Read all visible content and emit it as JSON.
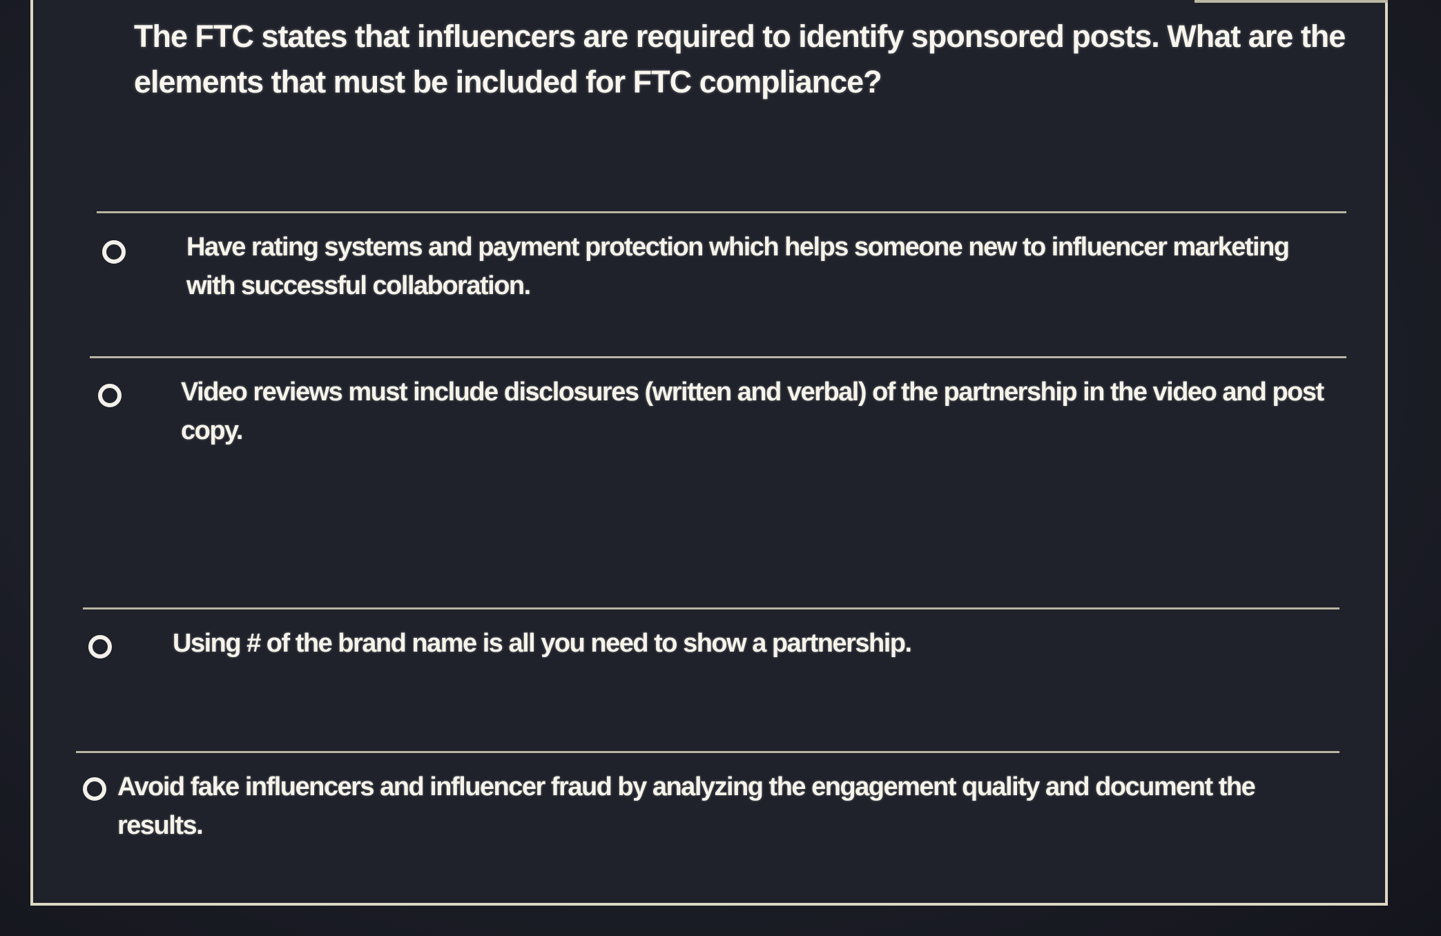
{
  "question": {
    "text": "The FTC states that influencers are required to identify sponsored posts. What are the elements that must be included for FTC compliance?"
  },
  "options": [
    {
      "label": "Have rating systems and payment protection which helps someone new to influencer marketing with successful collaboration.",
      "selected": false
    },
    {
      "label": "Video reviews must include disclosures (written and verbal) of the partnership in the video and post copy.",
      "selected": false
    },
    {
      "label": "Using # of the brand name is all you need to show a partnership.",
      "selected": false
    },
    {
      "label": "Avoid fake influencers and influencer fraud by analyzing the engagement quality and document the results.",
      "selected": false
    }
  ],
  "colors": {
    "background": "#1f212b",
    "border": "#ddd8c2",
    "text": "#f5f3ea"
  }
}
